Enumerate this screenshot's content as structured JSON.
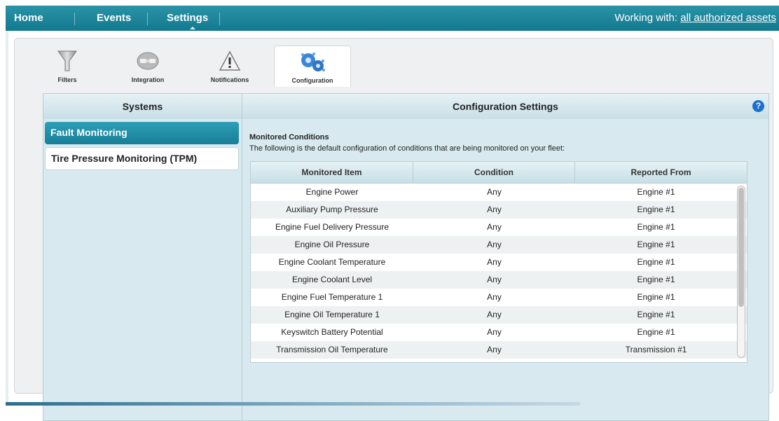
{
  "nav": {
    "home": "Home",
    "events": "Events",
    "settings": "Settings",
    "working_with_label": "Working with:",
    "working_with_link": "all authorized assets"
  },
  "tabs": [
    {
      "label": "Filters",
      "icon": "filter-icon"
    },
    {
      "label": "Integration",
      "icon": "integration-icon"
    },
    {
      "label": "Notifications",
      "icon": "warning-icon"
    },
    {
      "label": "Configuration",
      "icon": "gears-icon"
    }
  ],
  "systems": {
    "header": "Systems",
    "items": [
      "Fault Monitoring",
      "Tire Pressure Monitoring (TPM)"
    ]
  },
  "config": {
    "header": "Configuration Settings",
    "help": "?",
    "section_title": "Monitored Conditions",
    "section_desc": "The following is the default configuration of conditions that are being monitored on your fleet:",
    "columns": [
      "Monitored Item",
      "Condition",
      "Reported From"
    ],
    "rows": [
      [
        "Engine Power",
        "Any",
        "Engine #1"
      ],
      [
        "Auxiliary Pump Pressure",
        "Any",
        "Engine #1"
      ],
      [
        "Engine Fuel Delivery Pressure",
        "Any",
        "Engine #1"
      ],
      [
        "Engine Oil Pressure",
        "Any",
        "Engine #1"
      ],
      [
        "Engine Coolant Temperature",
        "Any",
        "Engine #1"
      ],
      [
        "Engine Coolant Level",
        "Any",
        "Engine #1"
      ],
      [
        "Engine Fuel Temperature 1",
        "Any",
        "Engine #1"
      ],
      [
        "Engine Oil Temperature 1",
        "Any",
        "Engine #1"
      ],
      [
        "Keyswitch Battery Potential",
        "Any",
        "Engine #1"
      ],
      [
        "Transmission Oil Temperature",
        "Any",
        "Transmission #1"
      ]
    ]
  },
  "colors": {
    "nav_bg": "#1a8599",
    "accent": "#2e9fb7",
    "help_blue": "#1d6fd0"
  }
}
